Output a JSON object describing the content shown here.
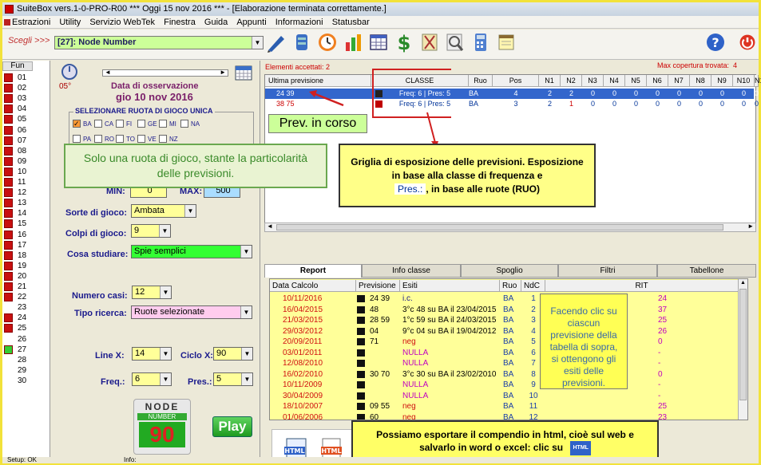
{
  "window": {
    "title": "SuiteBox vers.1-0-PRO-R00  ***  Oggi 15 nov 2016  ***   - [Elaborazione terminata correttamente.]"
  },
  "menu": [
    "Estrazioni",
    "Utility",
    "Servizio WebTek",
    "Finestra",
    "Guida",
    "Appunti",
    "Informazioni",
    "Statusbar"
  ],
  "choose": {
    "label": "Scegli >>>",
    "value": "[27]: Node Number"
  },
  "fun": {
    "header": "Fun",
    "rows": [
      "01",
      "02",
      "03",
      "04",
      "05",
      "06",
      "07",
      "08",
      "09",
      "10",
      "11",
      "12",
      "13",
      "14",
      "15",
      "16",
      "17",
      "18",
      "19",
      "20",
      "21",
      "22",
      "23",
      "24",
      "25",
      "26",
      "27",
      "28",
      "29",
      "30"
    ]
  },
  "panel": {
    "angle": "05°",
    "date_title": "Data di osservazione",
    "date_value": "gio 10 nov 2016",
    "ruota_title": "SELEZIONARE RUOTA DI GIOCO UNICA",
    "ruote": [
      "BA",
      "CA",
      "FI",
      "GE",
      "MI",
      "NA",
      "PA",
      "RO",
      "TO",
      "VE",
      "NZ"
    ],
    "min_label": "MIN:",
    "min_value": "0",
    "max_label": "MAX:",
    "max_value": "500",
    "sorte_label": "Sorte di gioco:",
    "sorte_value": "Ambata",
    "colpi_label": "Colpi di gioco:",
    "colpi_value": "9",
    "cosa_label": "Cosa studiare:",
    "cosa_value": "Spie semplici",
    "casi_label": "Numero casi:",
    "casi_value": "12",
    "tipo_label": "Tipo ricerca:",
    "tipo_value": "Ruote selezionate",
    "linex_label": "Line X:",
    "linex_value": "14",
    "ciclox_label": "Ciclo X:",
    "ciclox_value": "90",
    "freq_label": "Freq.:",
    "freq_value": "6",
    "pres_label": "Pres.:",
    "pres_value": "5",
    "logo_top": "NODE",
    "logo_mid": "NUMBER",
    "logo_num": "90",
    "play": "Play"
  },
  "info": {
    "accepted": "Elementi accettati: 2",
    "max_cov": "Max copertura trovata:",
    "max_cov_value": "4"
  },
  "grid": {
    "headers": [
      "Ultima previsione",
      "CLASSE",
      "Ruo",
      "Pos",
      "N1",
      "N2",
      "N3",
      "N4",
      "N5",
      "N6",
      "N7",
      "N8",
      "N9",
      "N10",
      "N1"
    ],
    "rows": [
      {
        "prev": "24 39",
        "classe": "Freq: 6 | Pres: 5",
        "ruo": "BA",
        "pos": "4",
        "n": [
          "2",
          "2",
          "0",
          "0",
          "0",
          "0",
          "0",
          "0",
          "0",
          "0",
          "0"
        ],
        "color": "#003399"
      },
      {
        "prev": "38 75",
        "classe": "Freq: 6 | Pres: 5",
        "ruo": "BA",
        "pos": "3",
        "n": [
          "2",
          "1",
          "0",
          "0",
          "0",
          "0",
          "0",
          "0",
          "0",
          "0",
          "0"
        ],
        "color": "#cc0000"
      }
    ]
  },
  "tabs": [
    "Report",
    "Info classe",
    "Spoglio",
    "Filtri",
    "Tabellone"
  ],
  "report": {
    "headers": [
      "Data Calcolo",
      "Previsione",
      "Esiti",
      "Ruo",
      "NdC",
      "RIT"
    ],
    "rows": [
      {
        "date": "10/11/2016",
        "prev": "24 39",
        "esito": "i.c.",
        "ruo": "BA",
        "ndc": "1",
        "rit": "24",
        "red": false
      },
      {
        "date": "16/04/2015",
        "prev": "48",
        "esito": "3°c 48 su BA il 23/04/2015",
        "ruo": "BA",
        "ndc": "2",
        "rit": "37",
        "red": false
      },
      {
        "date": "21/03/2015",
        "prev": "28 59",
        "esito": "1°c 59 su BA il 24/03/2015",
        "ruo": "BA",
        "ndc": "3",
        "rit": "25",
        "red": false
      },
      {
        "date": "29/03/2012",
        "prev": "04",
        "esito": "9°c 04 su BA il 19/04/2012",
        "ruo": "BA",
        "ndc": "4",
        "rit": "26",
        "red": false
      },
      {
        "date": "20/09/2011",
        "prev": "71",
        "esito": "neg",
        "ruo": "BA",
        "ndc": "5",
        "rit": "0",
        "red": true
      },
      {
        "date": "03/01/2011",
        "prev": "",
        "esito": "NULLA",
        "ruo": "BA",
        "ndc": "6",
        "rit": "-",
        "red": true
      },
      {
        "date": "12/08/2010",
        "prev": "",
        "esito": "NULLA",
        "ruo": "BA",
        "ndc": "7",
        "rit": "-",
        "red": true
      },
      {
        "date": "16/02/2010",
        "prev": "30 70",
        "esito": "3°c 30 su BA il 23/02/2010",
        "ruo": "BA",
        "ndc": "8",
        "rit": "0",
        "red": false
      },
      {
        "date": "10/11/2009",
        "prev": "",
        "esito": "NULLA",
        "ruo": "BA",
        "ndc": "9",
        "rit": "-",
        "red": true
      },
      {
        "date": "30/04/2009",
        "prev": "",
        "esito": "NULLA",
        "ruo": "BA",
        "ndc": "10",
        "rit": "-",
        "red": true
      },
      {
        "date": "18/10/2007",
        "prev": "09 55",
        "esito": "neg",
        "ruo": "BA",
        "ndc": "11",
        "rit": "25",
        "red": false
      },
      {
        "date": "01/06/2006",
        "prev": "60",
        "esito": "neg",
        "ruo": "BA",
        "ndc": "12",
        "rit": "23",
        "red": false
      }
    ]
  },
  "annotations": {
    "prev_corso": "Prev. in corso",
    "solo_ruota": "Solo una ruota di gioco, stante la particolarità delle previsioni.",
    "griglia_1": "Griglia di esposizione delle previsioni. Esposizione in base alla classe di frequenza e",
    "griglia_pres": "Pres.:",
    "griglia_2": ", in base alle ruote (RUO)",
    "facendo": "Facendo clic su ciascun previsione della tabella di sopra, si ottengono gli esiti delle previsioni.",
    "esporta": "Possiamo esportare il compendio in html, cioè sul web e salvarlo in word o excel: clic su",
    "html_icon": "HTML"
  },
  "status": {
    "setup": "Setup: OK",
    "info": "Info:"
  },
  "colors": {
    "accent_green": "#ccff99",
    "yellow_input": "#ffff99",
    "red": "#cc0000",
    "blue_select": "#3366cc"
  }
}
